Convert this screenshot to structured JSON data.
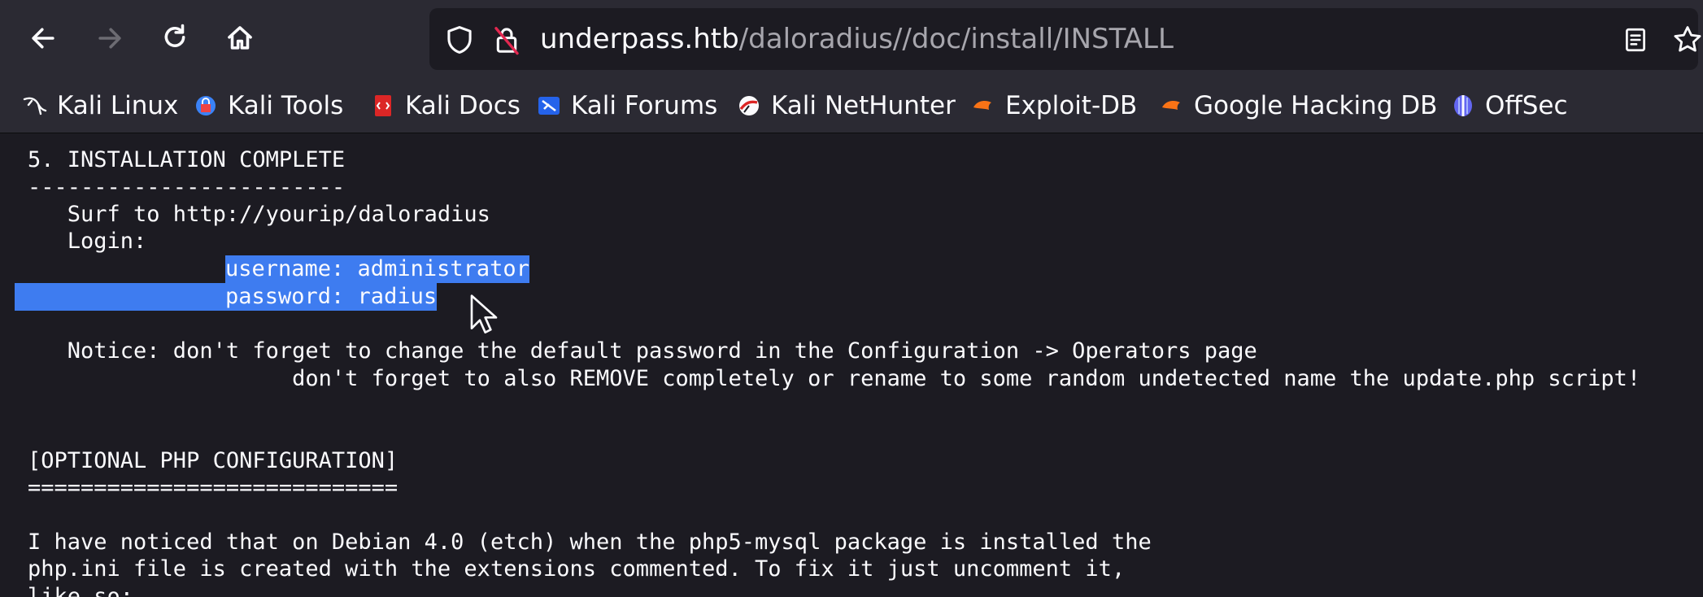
{
  "toolbar": {
    "url_host": "underpass.htb",
    "url_path": "/daloradius//doc/install/INSTALL",
    "icons": [
      "back-arrow-icon",
      "forward-arrow-icon",
      "reload-icon",
      "home-icon",
      "shield-icon",
      "insecure-lock-icon",
      "reader-view-icon",
      "bookmark-star-icon"
    ]
  },
  "bookmarks": [
    {
      "label": "Kali Linux",
      "icon": "kali-dragon-icon"
    },
    {
      "label": "Kali Tools",
      "icon": "kali-tools-icon"
    },
    {
      "label": "Kali Docs",
      "icon": "kali-docs-icon"
    },
    {
      "label": "Kali Forums",
      "icon": "kali-forums-icon"
    },
    {
      "label": "Kali NetHunter",
      "icon": "kali-nethunter-icon"
    },
    {
      "label": "Exploit-DB",
      "icon": "exploit-db-icon"
    },
    {
      "label": "Google Hacking DB",
      "icon": "ghdb-icon"
    },
    {
      "label": "OffSec",
      "icon": "offsec-icon"
    }
  ],
  "document": {
    "heading": "5. INSTALLATION COMPLETE",
    "heading_rule": "------------------------",
    "surf": "   Surf to http://yourip/daloradius",
    "login": "   Login:",
    "username": "username: administrator",
    "password": "password: radius",
    "notice_1": "   Notice: don't forget to change the default password in the Configuration -> Operators page",
    "notice_2": "                    don't forget to also REMOVE completely or rename to some random undetected name the update.php script!",
    "optional_heading": "[OPTIONAL PHP CONFIGURATION]",
    "optional_rule": "============================",
    "para_1": "I have noticed that on Debian 4.0 (etch) when the php5-mysql package is installed the",
    "para_2": "php.ini file is created with the extensions commented. To fix it just uncomment it,",
    "para_3": "like so:"
  },
  "colors": {
    "chrome": "#2b2a33",
    "page_background": "#1c1b22",
    "text": "#fbfbfe",
    "selection": "#3e7cf0"
  }
}
